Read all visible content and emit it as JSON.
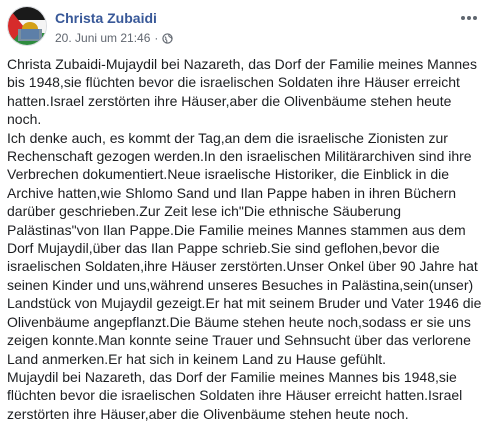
{
  "post": {
    "author": "Christa Zubaidi",
    "timestamp": "20. Juni um 21:46",
    "separator": "·",
    "privacy_icon": "globe-icon",
    "menu_icon": "more-options-icon",
    "link_color": "#385898",
    "lines": [
      "Christa Zubaidi-Mujaydil bei Nazareth, das Dorf der Familie meines Mannes",
      "bis 1948,sie flüchten bevor die israelischen Soldaten ihre Häuser erreicht",
      "hatten.Israel zerstörten ihre Häuser,aber die Olivenbäume stehen heute",
      "noch.",
      "Ich denke auch, es kommt der Tag,an dem die israelische Zionisten zur",
      "Rechenschaft gezogen werden.In den israelischen Militärarchiven sind ihre",
      "Verbrechen dokumentiert.Neue israelische Historiker, die Einblick in die",
      "Archive hatten,wie Shlomo Sand und Ilan Pappe haben in ihren Büchern",
      "darüber geschrieben.Zur Zeit lese ich\"Die ethnische Säuberung",
      "Palästinas\"von Ilan Pappe.Die Familie meines Mannes stammen aus dem",
      "Dorf Mujaydil,über das Ilan Pappe schrieb.Sie sind geflohen,bevor die",
      "israelischen Soldaten,ihre Häuser zerstörten.Unser Onkel über 90 Jahre hat",
      "seinen Kinder und uns,während unseres Besuches in Palästina,sein(unser)",
      "Landstück von Mujaydil gezeigt.Er hat mit seinem Bruder und Vater 1946 die",
      "Olivenbäume angepflanzt.Die Bäume stehen heute noch,sodass er sie uns",
      "zeigen konnte.Man konnte seine Trauer und Sehnsucht über das verlorene",
      "Land anmerken.Er hat sich in keinem Land zu Hause gefühlt.",
      "Mujaydil bei Nazareth, das Dorf der Familie meines Mannes bis 1948,sie",
      "flüchten bevor die israelischen Soldaten ihre Häuser erreicht hatten.Israel",
      "zerstörten ihre Häuser,aber die Olivenbäume stehen heute noch."
    ]
  }
}
